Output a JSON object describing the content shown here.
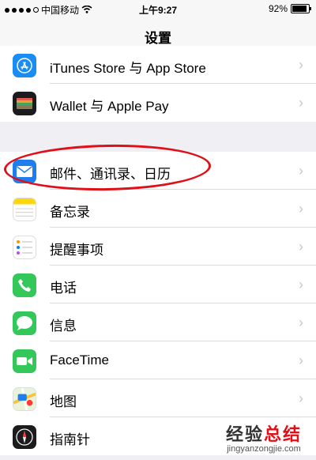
{
  "status": {
    "carrier": "中国移动",
    "time": "上午9:27",
    "battery": "92%",
    "battery_level": 0.92,
    "signal_bars": 4
  },
  "nav": {
    "title": "设置"
  },
  "groups": [
    [
      {
        "label": "iTunes Store 与 App Store",
        "icon": "app-store-icon",
        "color": "#1a8df5"
      },
      {
        "label": "Wallet 与 Apple Pay",
        "icon": "wallet-icon",
        "color": "#1c1c1e"
      }
    ],
    [
      {
        "label": "邮件、通讯录、日历",
        "icon": "mail-icon",
        "color": "#1e7ef0",
        "highlighted": true
      },
      {
        "label": "备忘录",
        "icon": "notes-icon",
        "color": "#ffd60a"
      },
      {
        "label": "提醒事项",
        "icon": "reminders-icon",
        "color": "#ffffff"
      },
      {
        "label": "电话",
        "icon": "phone-icon",
        "color": "#34c759"
      },
      {
        "label": "信息",
        "icon": "messages-icon",
        "color": "#34c759"
      },
      {
        "label": "FaceTime",
        "icon": "facetime-icon",
        "color": "#34c759"
      },
      {
        "label": "地图",
        "icon": "maps-icon",
        "color": "#8fd3ff"
      },
      {
        "label": "指南针",
        "icon": "compass-icon",
        "color": "#1c1c1e"
      }
    ]
  ],
  "watermark": {
    "title_dark": "经验",
    "title_red": "总结",
    "url": "jingyanzongjie.com"
  }
}
